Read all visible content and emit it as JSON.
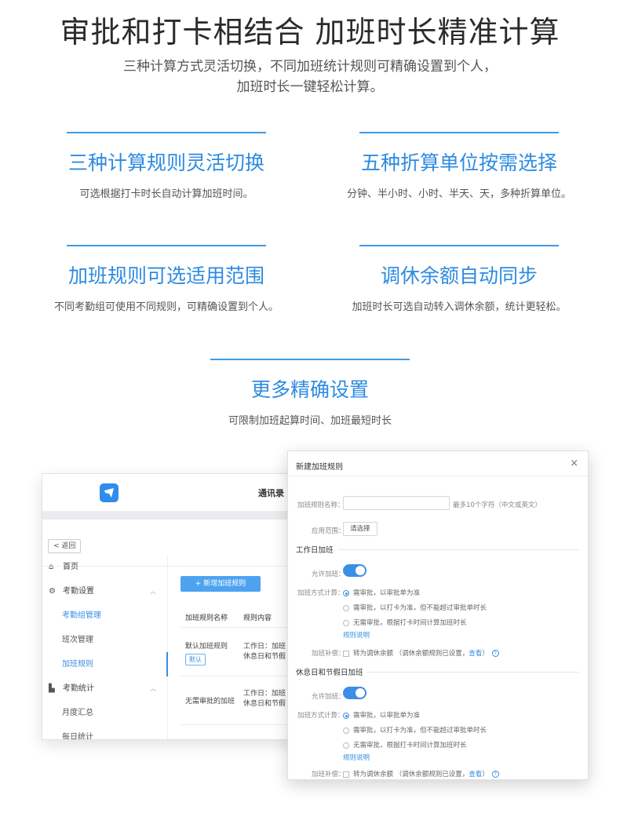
{
  "hero": {
    "title": "审批和打卡相结合 加班时长精准计算",
    "subtitle_line1": "三种计算方式灵活切换，不同加班统计规则可精确设置到个人，",
    "subtitle_line2": "加班时长一键轻松计算。"
  },
  "features": [
    {
      "title": "三种计算规则灵活切换",
      "desc": "可选根据打卡时长自动计算加班时间。"
    },
    {
      "title": "五种折算单位按需选择",
      "desc": "分钟、半小时、小时、半天、天，多种折算单位。"
    },
    {
      "title": "加班规则可选适用范围",
      "desc": "不同考勤组可使用不同规则，可精确设置到个人。"
    },
    {
      "title": "调休余额自动同步",
      "desc": "加班时长可选自动转入调休余额，统计更轻松。"
    },
    {
      "title": "更多精确设置",
      "desc": "可限制加班起算时间、加班最短时长"
    }
  ],
  "app": {
    "top_title": "通讯录",
    "back_label": "返回",
    "sidebar": [
      {
        "label": "首页",
        "icon": "home-icon"
      },
      {
        "label": "考勤设置",
        "icon": "settings-icon"
      },
      {
        "label": "考勤组管理"
      },
      {
        "label": "班次管理"
      },
      {
        "label": "加班规则"
      },
      {
        "label": "考勤统计",
        "icon": "chart-icon"
      },
      {
        "label": "月度汇总"
      },
      {
        "label": "每日统计"
      }
    ],
    "add_button": "+ 新增加班规则",
    "table": {
      "headers": [
        "加班规则名称",
        "规则内容"
      ],
      "rows": [
        {
          "name": "默认加班规则",
          "tag": "默认",
          "content_line1": "工作日：加班",
          "content_line2": "休息日和节假"
        },
        {
          "name": "无需审批的加班",
          "content_line1": "工作日：加班",
          "content_line2": "休息日和节假"
        }
      ]
    }
  },
  "dialog": {
    "title": "新建加班规则",
    "close": "×",
    "name_label": "加班规则名称：",
    "name_hint": "最多10个字符（中文或英文）",
    "scope_label": "应用范围：",
    "scope_button": "请选择",
    "workday_section": "工作日加班",
    "holiday_section": "休息日和节假日加班",
    "allow_label": "允许加班：",
    "method_label": "加班方式计算：",
    "options": [
      "需审批，以审批单为准",
      "需审批，以打卡为准，但不能超过审批单时长",
      "无需审批，根据打卡时间计算加班时长"
    ],
    "rule_link": "规则说明",
    "comp_label": "加班补偿：",
    "comp_text": "转为调休余额 （调休余额规则已设置，",
    "comp_link": "查看",
    "comp_end": "）"
  }
}
